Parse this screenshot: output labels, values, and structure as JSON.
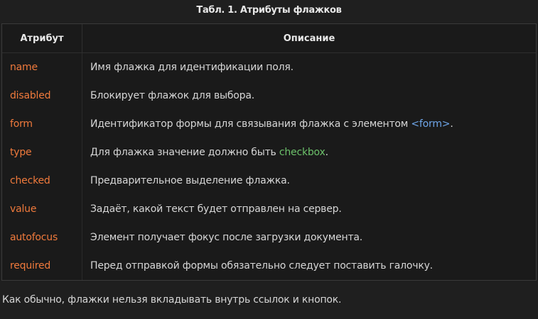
{
  "caption": "Табл. 1. Атрибуты флажков",
  "table": {
    "headers": [
      "Атрибут",
      "Описание"
    ],
    "rows": [
      {
        "attr": "name",
        "desc": "Имя флажка для идентификации поля."
      },
      {
        "attr": "disabled",
        "desc": "Блокирует флажок для выбора."
      },
      {
        "attr": "form",
        "desc_before": "Идентификатор формы для связывания флажка с элементом ",
        "desc_code": "<form>",
        "desc_after": "."
      },
      {
        "attr": "type",
        "desc_before": "Для флажка значение должно быть ",
        "desc_code": "checkbox",
        "desc_after": "."
      },
      {
        "attr": "checked",
        "desc": "Предварительное выделение флажка."
      },
      {
        "attr": "value",
        "desc": "Задаёт, какой текст будет отправлен на сервер."
      },
      {
        "attr": "autofocus",
        "desc": "Элемент получает фокус после загрузки документа."
      },
      {
        "attr": "required",
        "desc": "Перед отправкой формы обязательно следует поставить галочку."
      }
    ]
  },
  "note": "Как обычно, флажки нельзя вкладывать внутрь ссылок и кнопок.",
  "colors": {
    "attribute": "#f07a3c",
    "tag_code": "#6ea5e8",
    "value_code": "#6cc16a"
  }
}
